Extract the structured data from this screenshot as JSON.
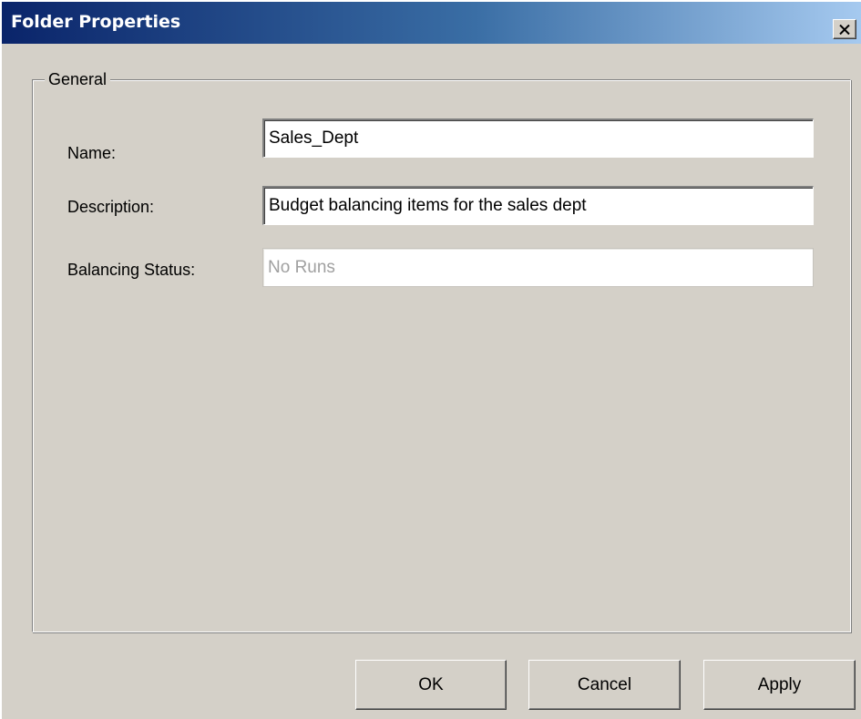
{
  "window": {
    "title": "Folder Properties"
  },
  "icons": {
    "close": "close-icon"
  },
  "colors": {
    "titlebar_start": "#0a246a",
    "titlebar_end": "#a6caf0",
    "face": "#d4d0c8",
    "disabled_text": "#a0a0a0"
  },
  "general": {
    "legend": "General",
    "name_label": "Name:",
    "name_value": "Sales_Dept",
    "description_label": "Description:",
    "description_value": "Budget balancing items for the sales dept",
    "status_label": "Balancing Status:",
    "status_value": "No Runs"
  },
  "buttons": {
    "ok": "OK",
    "cancel": "Cancel",
    "apply": "Apply"
  }
}
